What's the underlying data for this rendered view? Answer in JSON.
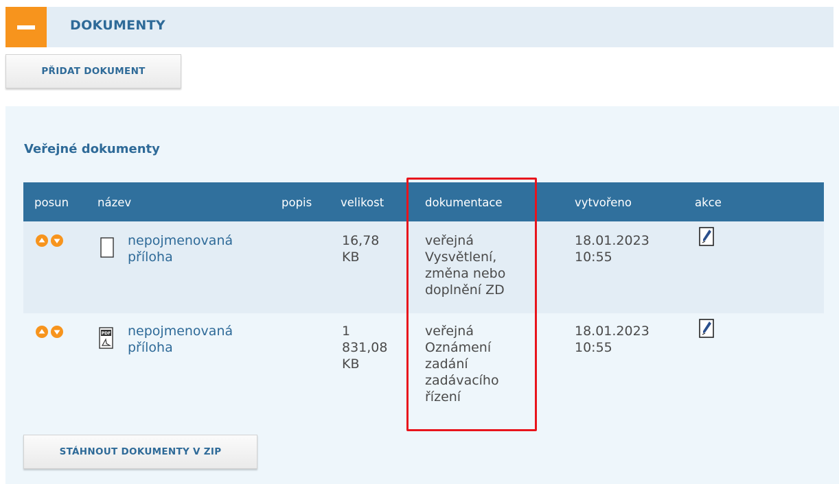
{
  "header": {
    "title": "DOKUMENTY"
  },
  "toolbar": {
    "add_label": "PŘIDAT DOKUMENT"
  },
  "panel": {
    "title": "Veřejné dokumenty"
  },
  "table": {
    "columns": [
      "posun",
      "název",
      "popis",
      "velikost",
      "dokumentace",
      "vytvořeno",
      "akce"
    ],
    "rows": [
      {
        "name_line1": "nepojmenovaná",
        "name_line2": "příloha",
        "popis": "",
        "size": [
          "16,78",
          "KB"
        ],
        "doc": [
          "veřejná",
          "Vysvětlení,",
          "změna nebo",
          "doplnění ZD"
        ],
        "created": [
          "18.01.2023",
          "10:55"
        ],
        "file_icon": "blank-file-icon"
      },
      {
        "name_line1": "nepojmenovaná",
        "name_line2": "příloha",
        "popis": "",
        "size": [
          "1",
          "831,08",
          "KB"
        ],
        "doc": [
          "veřejná",
          "Oznámení",
          "zadání",
          "zadávacího",
          "řízení"
        ],
        "created": [
          "18.01.2023",
          "10:55"
        ],
        "file_icon": "pdf-file-icon"
      }
    ]
  },
  "footer": {
    "zip_label": "STÁHNOUT DOKUMENTY V ZIP"
  },
  "colors": {
    "accent": "#f7941d",
    "header_bg": "#30709d",
    "link": "#2e6a98",
    "highlight": "#e8141c"
  }
}
